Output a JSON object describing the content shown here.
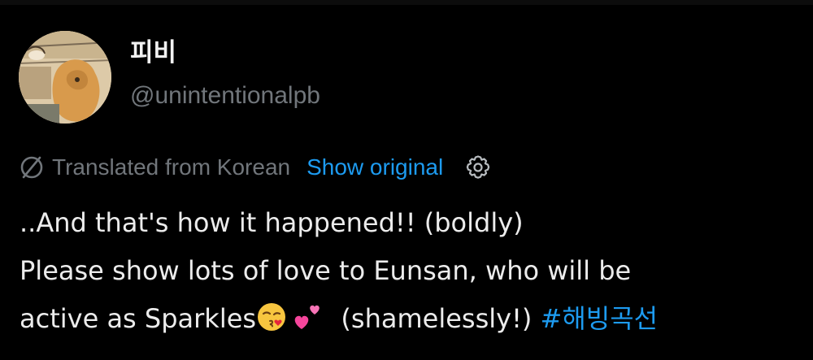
{
  "author": {
    "display_name": "피비",
    "handle": "@unintentionalpb"
  },
  "translation": {
    "icon": "globe-slash-icon",
    "label": "Translated from Korean",
    "show_original_label": "Show original",
    "settings_icon": "gear-icon"
  },
  "tweet": {
    "line1": "..And that's how it happened!! (boldly)",
    "line2": "Please show lots of love to Eunsan, who will be",
    "line3_text": "active as Sparkles",
    "emoji1": "kissing-face-emoji",
    "emoji2": "two-hearts-emoji",
    "line3_suffix": "(shamelessly!)",
    "hashtag": "#해빙곡선"
  },
  "colors": {
    "background": "#000000",
    "text_primary": "#e7e9ea",
    "text_secondary": "#71767b",
    "link": "#1d9bf0"
  }
}
